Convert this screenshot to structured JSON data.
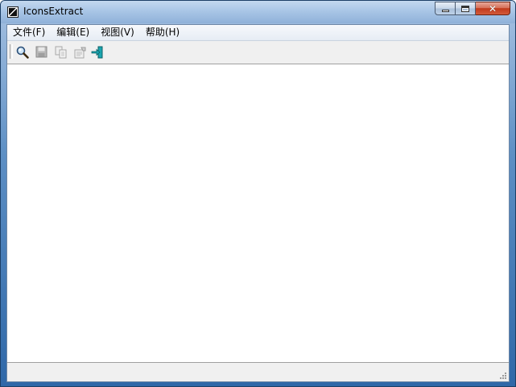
{
  "window": {
    "title": "IconsExtract",
    "close_glyph": "✕"
  },
  "menubar": {
    "items": [
      {
        "label": "文件(F)"
      },
      {
        "label": "编辑(E)"
      },
      {
        "label": "视图(V)"
      },
      {
        "label": "帮助(H)"
      }
    ]
  },
  "toolbar": {
    "buttons": [
      {
        "icon": "search-icon",
        "enabled": true
      },
      {
        "icon": "save-icon",
        "enabled": false
      },
      {
        "icon": "copy-icon",
        "enabled": false
      },
      {
        "icon": "properties-icon",
        "enabled": false
      },
      {
        "icon": "exit-icon",
        "enabled": true
      }
    ]
  },
  "statusbar": {
    "text": ""
  },
  "colors": {
    "title_bar": "#a9c6e6",
    "close_button": "#c0391b",
    "exit_icon": "#1aa6b0"
  }
}
